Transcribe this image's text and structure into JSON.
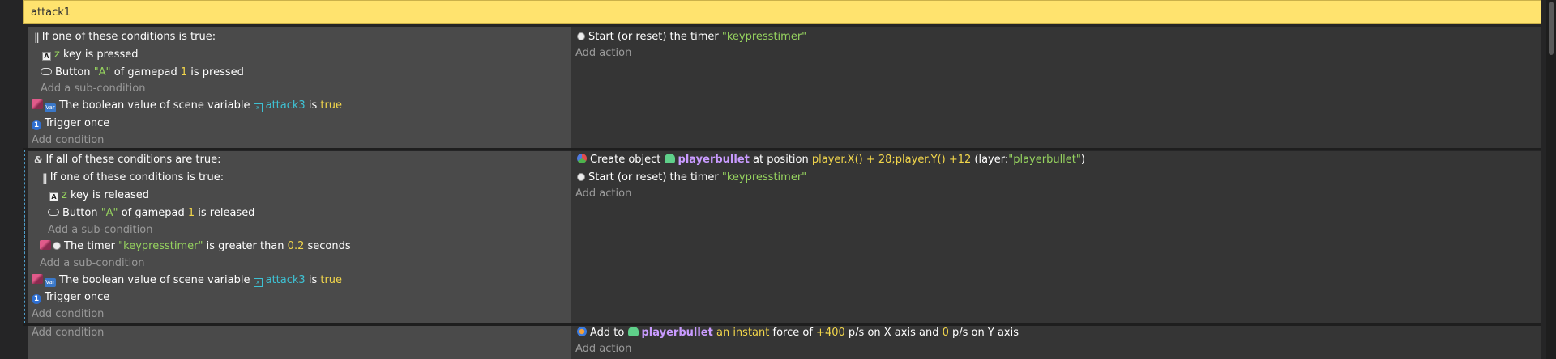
{
  "group": {
    "title": "attack1"
  },
  "events": [
    {
      "conditions": {
        "or_header": "If one of these conditions is true:",
        "key_z": {
          "key": "z",
          "text": "key is pressed"
        },
        "gamepad": {
          "pre": "Button",
          "button": "\"A\"",
          "mid": "of gamepad",
          "pad": "1",
          "post": "is pressed"
        },
        "add_sub": "Add a sub-condition",
        "scenevar": {
          "pre": "The boolean value of scene variable",
          "var": "attack3",
          "mid": "is",
          "value": "true"
        },
        "trigger": "Trigger once",
        "add_condition": "Add condition"
      },
      "actions": {
        "timer": {
          "pre": "Start (or reset) the timer",
          "name": "\"keypresstimer\""
        },
        "add_action": "Add action"
      }
    },
    {
      "conditions": {
        "and_header": "If all of these conditions are true:",
        "or_header": "If one of these conditions is true:",
        "key_z": {
          "key": "z",
          "text": "key is released"
        },
        "gamepad": {
          "pre": "Button",
          "button": "\"A\"",
          "mid": "of gamepad",
          "pad": "1",
          "post": "is released"
        },
        "add_sub_inner": "Add a sub-condition",
        "timer": {
          "pre": "The timer",
          "name": "\"keypresstimer\"",
          "mid": "is greater than",
          "value": "0.2",
          "post": "seconds"
        },
        "add_sub_outer": "Add a sub-condition",
        "scenevar": {
          "pre": "The boolean value of scene variable",
          "var": "attack3",
          "mid": "is",
          "value": "true"
        },
        "trigger": "Trigger once",
        "add_condition": "Add condition"
      },
      "actions": {
        "create": {
          "pre": "Create object",
          "object": "playerbullet",
          "mid": "at position",
          "expr": "player.X() + 28;player.Y() +12",
          "layer_pre": "(layer:",
          "layer": "\"playerbullet\"",
          "layer_post": ")"
        },
        "timer": {
          "pre": "Start (or reset) the timer",
          "name": "\"keypresstimer\""
        },
        "add_action": "Add action"
      }
    },
    {
      "conditions": {
        "add_condition": "Add condition"
      },
      "actions": {
        "force": {
          "pre": "Add to",
          "object": "playerbullet",
          "kind": "an instant",
          "mid": "force of",
          "x": "+400",
          "x_post": "p/s on X axis and",
          "y": "0",
          "y_post": "p/s on Y axis"
        },
        "add_action": "Add action"
      }
    }
  ]
}
